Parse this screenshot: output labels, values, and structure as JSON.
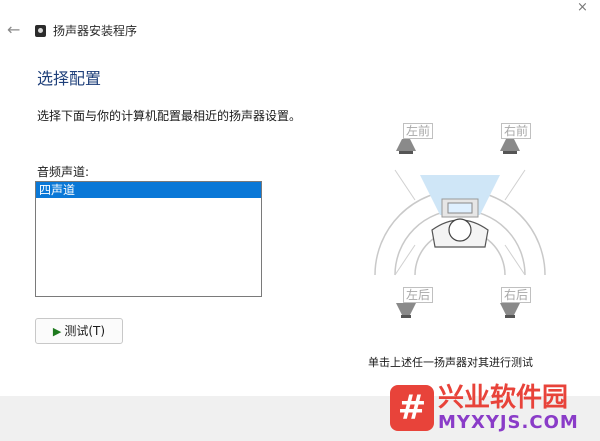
{
  "window": {
    "title": "扬声器安装程序",
    "back_glyph": "←",
    "close_glyph": "×"
  },
  "page": {
    "title": "选择配置",
    "description": "选择下面与你的计算机配置最相近的扬声器设置。",
    "channels_label": "音频声道:",
    "channels": [
      "四声道"
    ],
    "selected_channel": "四声道"
  },
  "test_button": {
    "label": "测试(T)",
    "icon": "play-icon"
  },
  "diagram": {
    "speakers": [
      {
        "label": "左前"
      },
      {
        "label": "右前"
      },
      {
        "label": "左后"
      },
      {
        "label": "右后"
      }
    ],
    "caption": "单击上述任一扬声器对其进行测试"
  },
  "watermark": {
    "symbol": "#",
    "name": "兴业软件园",
    "domain": "MYXYJS.COM"
  },
  "colors": {
    "accent": "#0a78d7",
    "title": "#1e3f7a",
    "watermark_red": "#e8433a",
    "watermark_purple": "#8a3cc8"
  }
}
